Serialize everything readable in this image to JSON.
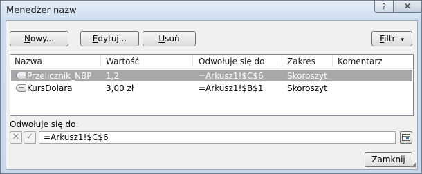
{
  "window": {
    "title": "Menedżer nazw",
    "help_label": "?",
    "close_label": "✕"
  },
  "toolbar": {
    "new_label": "Nowy...",
    "new_mnemonic": "N",
    "new_rest": "owy...",
    "edit_label": "Edytuj...",
    "edit_mnemonic": "E",
    "edit_rest": "dytuj...",
    "delete_label": "Usuń",
    "delete_mnemonic": "U",
    "delete_rest": "suń",
    "filter_label": "Filtr",
    "filter_mnemonic": "F",
    "filter_rest": "iltr",
    "filter_arrow": "▾"
  },
  "table": {
    "headers": [
      "Nazwa",
      "Wartość",
      "Odwołuje się do",
      "Zakres",
      "Komentarz"
    ],
    "rows": [
      {
        "name": "Przelicznik_NBP",
        "value": "1,2",
        "ref": "=Arkusz1!$C$6",
        "scope": "Skoroszyt",
        "comment": "",
        "selected": true
      },
      {
        "name": "KursDolara",
        "value": "3,00 zł",
        "ref": "=Arkusz1!$B$1",
        "scope": "Skoroszyt",
        "comment": "",
        "selected": false
      }
    ]
  },
  "refers": {
    "label": "Odwołuje się do:",
    "cancel_icon": "✕",
    "confirm_icon": "✓",
    "value": "=Arkusz1!$C$6"
  },
  "footer": {
    "close_label": "Zamknij"
  },
  "colors": {
    "selection": "#a8a8a8",
    "window_bg": "#cfdff1"
  }
}
